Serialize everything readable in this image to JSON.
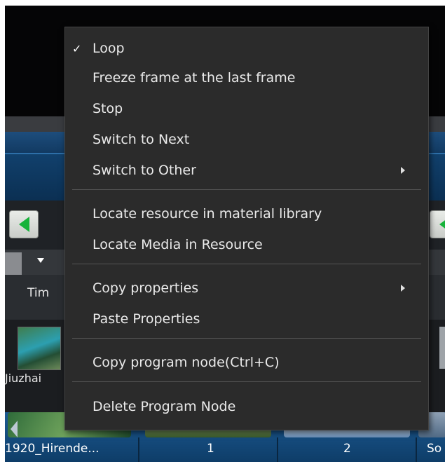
{
  "background": {
    "timeline_header": "Tim",
    "media_clip_label": "Jiuzhai",
    "bottom_labels": [
      "1920_Hirende...",
      "1",
      "2",
      "So"
    ]
  },
  "menu": {
    "items": [
      {
        "label": "Loop",
        "checked": true
      },
      {
        "label": "Freeze frame at the last frame"
      },
      {
        "label": "Stop"
      },
      {
        "label": "Switch to Next"
      },
      {
        "label": "Switch to Other",
        "submenu": true
      },
      {
        "label": "Locate resource in material library"
      },
      {
        "label": "Locate Media in Resource"
      },
      {
        "label": "Copy properties",
        "submenu": true
      },
      {
        "label": "Paste Properties"
      },
      {
        "label": "Copy program node(Ctrl+C)"
      },
      {
        "label": "Delete Program Node"
      }
    ],
    "check_mark": "✓"
  },
  "colors": {
    "menu_bg": "#2b2b2b",
    "accent_green": "#17b33a",
    "timeline_blue": "#1c5a93"
  }
}
